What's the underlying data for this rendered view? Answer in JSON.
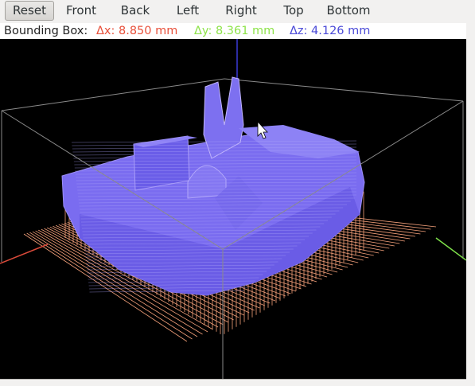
{
  "toolbar": {
    "buttons": [
      {
        "label": "Reset",
        "active": true
      },
      {
        "label": "Front"
      },
      {
        "label": "Back"
      },
      {
        "label": "Left"
      },
      {
        "label": "Right"
      },
      {
        "label": "Top"
      },
      {
        "label": "Bottom"
      }
    ]
  },
  "bounding_box": {
    "label": "Bounding Box:",
    "dx": "Δx: 8.850 mm",
    "dy": "Δy: 8.361 mm",
    "dz": "Δz: 4.126 mm",
    "dx_color": "#e8503a",
    "dy_color": "#8ee34a",
    "dz_color": "#4a4ad8"
  },
  "viewport": {
    "background": "#000000",
    "model_fill": "#7a6cf0",
    "toolpath_color": "#f4a07a",
    "x_axis_color": "#d94a3a",
    "y_axis_color": "#7ee04a",
    "z_axis_color": "#3a3ad8",
    "box_color": "#9a9a9a"
  }
}
